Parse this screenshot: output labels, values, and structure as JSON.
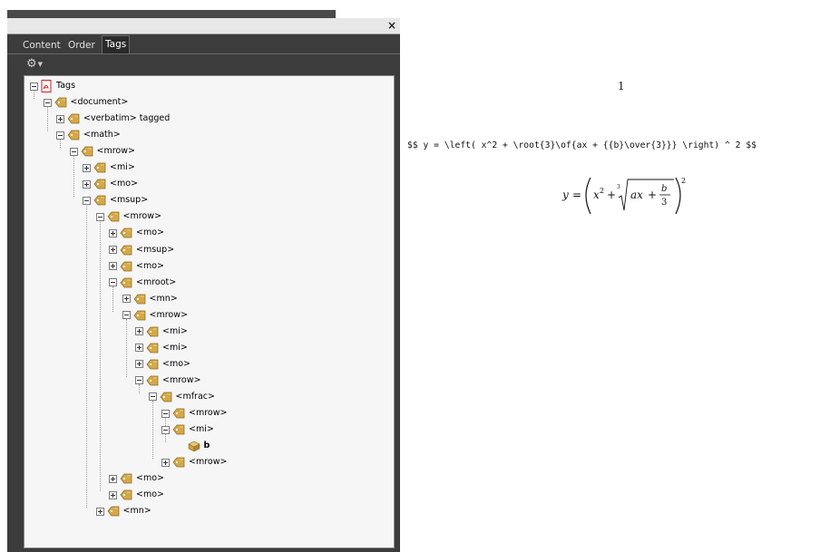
{
  "panel": {
    "close_symbol": "×",
    "tabs": [
      {
        "label": "Content",
        "active": false
      },
      {
        "label": "Order",
        "active": false
      },
      {
        "label": "Tags",
        "active": true
      }
    ],
    "options_icon": "gear-icon"
  },
  "tree": [
    {
      "label": "Tags",
      "icon": "pdf-icon",
      "toggle": "minus"
    },
    {
      "label": "<document>",
      "icon": "tag-icon",
      "toggle": "minus"
    },
    {
      "label": "<verbatim> tagged",
      "icon": "tag-icon",
      "toggle": "plus"
    },
    {
      "label": "<math>",
      "icon": "tag-icon",
      "toggle": "minus"
    },
    {
      "label": "<mrow>",
      "icon": "tag-icon",
      "toggle": "minus"
    },
    {
      "label": "<mi>",
      "icon": "tag-icon",
      "toggle": "plus"
    },
    {
      "label": "<mo>",
      "icon": "tag-icon",
      "toggle": "plus"
    },
    {
      "label": "<msup>",
      "icon": "tag-icon",
      "toggle": "minus"
    },
    {
      "label": "<mrow>",
      "icon": "tag-icon",
      "toggle": "minus"
    },
    {
      "label": "<mo>",
      "icon": "tag-icon",
      "toggle": "plus"
    },
    {
      "label": "<msup>",
      "icon": "tag-icon",
      "toggle": "plus"
    },
    {
      "label": "<mo>",
      "icon": "tag-icon",
      "toggle": "plus"
    },
    {
      "label": "<mroot>",
      "icon": "tag-icon",
      "toggle": "minus"
    },
    {
      "label": "<mn>",
      "icon": "tag-icon",
      "toggle": "plus"
    },
    {
      "label": "<mrow>",
      "icon": "tag-icon",
      "toggle": "minus"
    },
    {
      "label": "<mi>",
      "icon": "tag-icon",
      "toggle": "plus"
    },
    {
      "label": "<mi>",
      "icon": "tag-icon",
      "toggle": "plus"
    },
    {
      "label": "<mo>",
      "icon": "tag-icon",
      "toggle": "plus"
    },
    {
      "label": "<mrow>",
      "icon": "tag-icon",
      "toggle": "minus"
    },
    {
      "label": "<mfrac>",
      "icon": "tag-icon",
      "toggle": "minus"
    },
    {
      "label": "<mrow>",
      "icon": "tag-icon",
      "toggle": "minus"
    },
    {
      "label": "<mi>",
      "icon": "tag-icon",
      "toggle": "minus"
    },
    {
      "label": "b",
      "icon": "content-box-icon",
      "toggle": "none"
    },
    {
      "label": "<mrow>",
      "icon": "tag-icon",
      "toggle": "plus"
    },
    {
      "label": "<mo>",
      "icon": "tag-icon",
      "toggle": "plus"
    },
    {
      "label": "<mo>",
      "icon": "tag-icon",
      "toggle": "plus"
    },
    {
      "label": "<mn>",
      "icon": "tag-icon",
      "toggle": "plus"
    }
  ],
  "document": {
    "page_number": "1",
    "source_line": "$$ y = \\left( x^2 + \\root{3}\\of{ax + {{b}\\over{3}}} \\right) ^ 2 $$",
    "formula": {
      "lhs": "y",
      "equals": "=",
      "base": "x",
      "base_exp": "2",
      "plus1": "+",
      "root_index": "3",
      "radicand": "ax",
      "plus2": "+",
      "frac_num": "b",
      "frac_den": "3",
      "outer_exp": "2"
    }
  },
  "colors": {
    "panel_dark": "#3c3c3c",
    "tree_bg": "#f6f6f6",
    "tag_gold": "#d4a84a",
    "pdf_red": "#c8201e"
  }
}
